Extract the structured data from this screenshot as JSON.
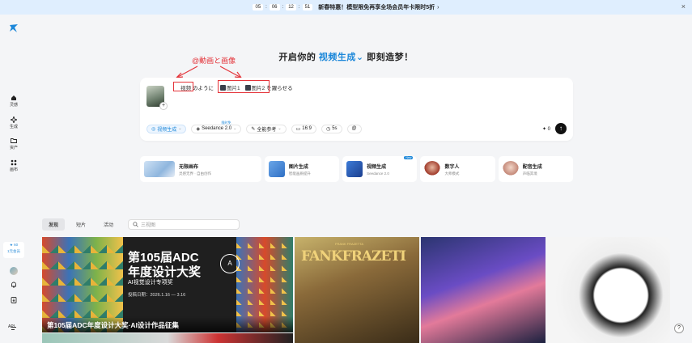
{
  "banner": {
    "countdown": [
      "05",
      "06",
      "12",
      "51"
    ],
    "promo_text": "新春特惠！模型限免再享全场会员年卡限时5折",
    "arrow": "›",
    "close": "×"
  },
  "sidebar": {
    "items": [
      {
        "label": "灵感",
        "icon": "home-icon"
      },
      {
        "label": "生成",
        "icon": "sparkle-icon"
      },
      {
        "label": "资产",
        "icon": "folder-icon"
      },
      {
        "label": "画布",
        "icon": "canvas-icon"
      }
    ],
    "credits_value": "★ 60",
    "credits_label": "1元会员",
    "api_label": "API"
  },
  "heading": {
    "prefix": "开启你的",
    "accent": "视频生成",
    "suffix": "即刻造梦！",
    "caret": "⌄"
  },
  "annotation": {
    "text": "@動画と画像"
  },
  "composer": {
    "ref_video": "视频",
    "mid_text": "のように",
    "ref_image1": "图片1",
    "ref_image2": "图片2",
    "end_text": "を躍らせる",
    "tool_mode": "视频生成",
    "tool_model": "Seedance 2.0",
    "tool_model_tag": "限时免",
    "tool_ref": "全能参考",
    "tool_ratio": "16:9",
    "tool_duration": "5s",
    "credit_cost": "0",
    "send_icon": "↑"
  },
  "cards": [
    {
      "title": "无限画布",
      "subtitle": "灵感无界 · 自由创作",
      "new": ""
    },
    {
      "title": "图片生成",
      "subtitle": "智能画质提升",
      "new": ""
    },
    {
      "title": "视频生成",
      "subtitle": "Seedance 2.0",
      "new": "New"
    },
    {
      "title": "数字人",
      "subtitle": "大师模式",
      "new": ""
    },
    {
      "title": "配音生成",
      "subtitle": "声临其境",
      "new": ""
    }
  ],
  "tabs": {
    "items": [
      "发现",
      "短片",
      "活动"
    ],
    "search_placeholder": "三视图"
  },
  "gallery": {
    "card1_title1": "第105届ADC",
    "card1_title2": "年度设计大奖",
    "card1_sub": "AI视觉设计专项奖",
    "card1_date": "投稿日期：2026.1.16 — 3.16",
    "card1_caption": "第105届ADC年度设计大奖·AI设计作品征集",
    "card2_title": "FANKFRAZETI",
    "card2_small": "FRANK FRAZETTA"
  },
  "help": "?"
}
